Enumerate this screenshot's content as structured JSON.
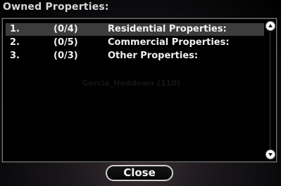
{
  "dialog": {
    "title": "Owned Properties:",
    "watermark": "Garcia_Hoddown (110)",
    "close_label": "Close"
  },
  "properties": [
    {
      "index": "1.",
      "count": "(0/4)",
      "name": "Residential Properties:",
      "selected": true
    },
    {
      "index": "2.",
      "count": "(0/5)",
      "name": "Commercial Properties:",
      "selected": false
    },
    {
      "index": "3.",
      "count": "(0/3)",
      "name": "Other Properties:",
      "selected": false
    }
  ],
  "icons": {
    "scroll_up": "arrow-up-icon",
    "scroll_down": "arrow-down-icon"
  },
  "colors": {
    "selection": "#3c3c3c",
    "text": "#f0f0f0",
    "title": "#d8d8d8"
  }
}
